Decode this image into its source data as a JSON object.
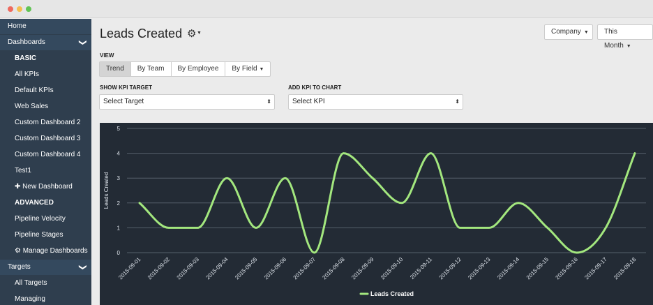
{
  "window": {
    "title": ""
  },
  "sidebar": {
    "items": [
      {
        "label": "Home",
        "kind": "top",
        "name": "sidebar-item-home"
      },
      {
        "label": "Dashboards",
        "kind": "top",
        "name": "sidebar-item-dashboards",
        "chevron": "chevron-down-icon"
      },
      {
        "label": "BASIC",
        "kind": "head",
        "name": "sidebar-heading-basic"
      },
      {
        "label": "All KPIs",
        "kind": "sub",
        "name": "sidebar-item-all-kpis"
      },
      {
        "label": "Default KPIs",
        "kind": "sub",
        "name": "sidebar-item-default-kpis"
      },
      {
        "label": "Web Sales",
        "kind": "sub",
        "name": "sidebar-item-web-sales"
      },
      {
        "label": "Custom Dashboard 2",
        "kind": "sub",
        "name": "sidebar-item-custom-dashboard-2"
      },
      {
        "label": "Custom Dashboard 3",
        "kind": "sub",
        "name": "sidebar-item-custom-dashboard-3"
      },
      {
        "label": "Custom Dashboard 4",
        "kind": "sub",
        "name": "sidebar-item-custom-dashboard-4"
      },
      {
        "label": "Test1",
        "kind": "sub",
        "name": "sidebar-item-test1"
      },
      {
        "label": "✚ New Dashboard",
        "kind": "sub",
        "name": "sidebar-item-new-dashboard"
      },
      {
        "label": "ADVANCED",
        "kind": "head",
        "name": "sidebar-heading-advanced"
      },
      {
        "label": "Pipeline Velocity",
        "kind": "sub",
        "name": "sidebar-item-pipeline-velocity"
      },
      {
        "label": "Pipeline Stages",
        "kind": "sub",
        "name": "sidebar-item-pipeline-stages"
      },
      {
        "label": "⚙ Manage Dashboards",
        "kind": "sub",
        "name": "sidebar-item-manage-dashboards"
      },
      {
        "label": "Targets",
        "kind": "top",
        "name": "sidebar-item-targets",
        "chevron": "chevron-down-icon"
      },
      {
        "label": "All Targets",
        "kind": "sub",
        "name": "sidebar-item-all-targets"
      },
      {
        "label": "Managing",
        "kind": "sub",
        "name": "sidebar-item-managing"
      }
    ]
  },
  "header": {
    "title": "Leads Created",
    "gear_icon": "gear-icon",
    "company_label": "Company",
    "period_label": "This Month"
  },
  "view": {
    "label": "VIEW",
    "tabs": [
      "Trend",
      "By Team",
      "By Employee",
      "By Field"
    ],
    "active": "Trend"
  },
  "kpi_target": {
    "label": "SHOW KPI TARGET",
    "value": "Select Target"
  },
  "add_kpi": {
    "label": "ADD KPI TO CHART",
    "value": "Select KPI"
  },
  "colors": {
    "sidebar_bg": "#2f3e4e",
    "chart_bg": "#232b35",
    "line": "#a3e77e"
  },
  "chart_data": {
    "type": "line",
    "title": "",
    "xlabel": "",
    "ylabel": "Leads Created",
    "ylim": [
      0,
      5
    ],
    "yticks": [
      "0",
      "1",
      "2",
      "3",
      "4",
      "5"
    ],
    "grid": true,
    "legend_position": "bottom-center",
    "categories": [
      "2015-09-01",
      "2015-09-02",
      "2015-09-03",
      "2015-09-04",
      "2015-09-05",
      "2015-09-06",
      "2015-09-07",
      "2015-09-08",
      "2015-09-09",
      "2015-09-10",
      "2015-09-11",
      "2015-09-12",
      "2015-09-13",
      "2015-09-14",
      "2015-09-15",
      "2015-09-16",
      "2015-09-17",
      "2015-09-18"
    ],
    "series": [
      {
        "name": "Leads Created",
        "values": [
          2,
          1,
          1,
          3,
          1,
          3,
          0,
          4,
          3,
          2,
          4,
          1,
          1,
          2,
          1,
          0,
          1,
          4
        ],
        "color": "#a3e77e"
      }
    ]
  }
}
